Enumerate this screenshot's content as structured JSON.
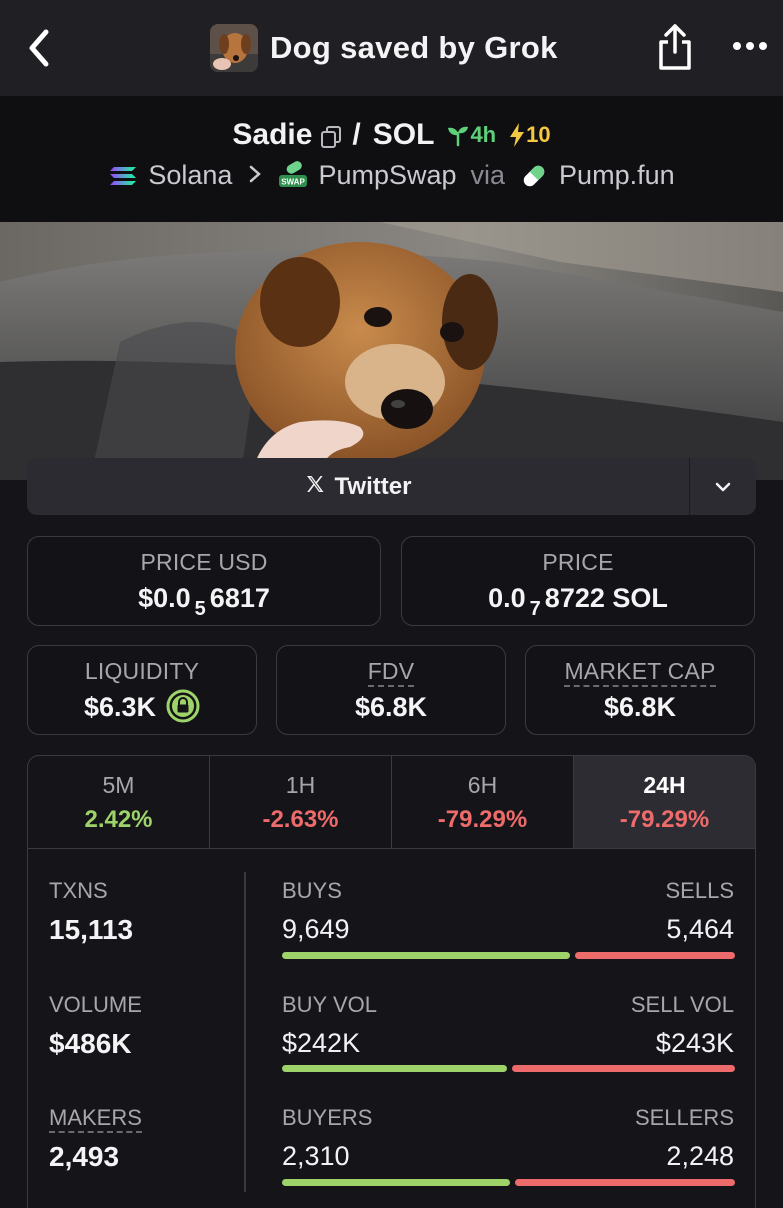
{
  "header": {
    "title": "Dog saved by Grok"
  },
  "pair": {
    "base": "Sadie",
    "slash": "/",
    "quote": "SOL",
    "age": "4h",
    "boosts": "10"
  },
  "chain": {
    "network": "Solana",
    "dex": "PumpSwap",
    "via": "via",
    "launchpad": "Pump.fun",
    "dex_badge": "SWAP"
  },
  "links": {
    "twitter_label": "Twitter"
  },
  "prices": {
    "price_usd_label": "PRICE USD",
    "price_usd_prefix": "$0.0",
    "price_usd_zeros": "5",
    "price_usd_digits": "6817",
    "price_label": "PRICE",
    "price_sol_prefix": "0.0",
    "price_sol_zeros": "7",
    "price_sol_digits": "8722 SOL"
  },
  "metrics": {
    "liquidity_label": "LIQUIDITY",
    "liquidity_value": "$6.3K",
    "fdv_label": "FDV",
    "fdv_value": "$6.8K",
    "mcap_label": "MARKET CAP",
    "mcap_value": "$6.8K"
  },
  "timeframes": [
    {
      "label": "5M",
      "change": "2.42%"
    },
    {
      "label": "1H",
      "change": "-2.63%"
    },
    {
      "label": "6H",
      "change": "-79.29%"
    },
    {
      "label": "24H",
      "change": "-79.29%"
    }
  ],
  "stats": {
    "txns_label": "TXNS",
    "txns_value": "15,113",
    "volume_label": "VOLUME",
    "volume_value": "$486K",
    "makers_label": "MAKERS",
    "makers_value": "2,493",
    "buys_label": "BUYS",
    "buys_value": "9,649",
    "sells_label": "SELLS",
    "sells_value": "5,464",
    "buyvol_label": "BUY VOL",
    "buyvol_value": "$242K",
    "sellvol_label": "SELL VOL",
    "sellvol_value": "$243K",
    "buyers_label": "BUYERS",
    "buyers_value": "2,310",
    "sellers_label": "SELLERS",
    "sellers_value": "2,248"
  },
  "colors": {
    "positive": "#9ed36a",
    "negative": "#ee6b6b",
    "age_green": "#5fd07a",
    "boost_yellow": "#f5c842"
  }
}
